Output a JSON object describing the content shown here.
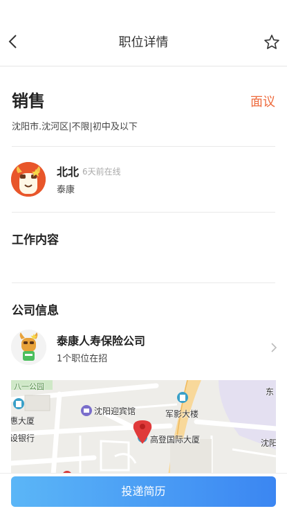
{
  "header": {
    "title": "职位详情"
  },
  "job": {
    "title": "销售",
    "salary": "面议",
    "meta": "沈阳市.沈河区|不限|初中及以下"
  },
  "contact": {
    "name": "北北",
    "online": "6天前在线",
    "company": "泰康"
  },
  "sections": {
    "work_content": "工作内容",
    "company_info": "公司信息"
  },
  "company": {
    "name": "泰康人寿保险公司",
    "positions": "1个职位在招"
  },
  "map": {
    "labels": {
      "park": "八一公园",
      "hotel": "沈阳迎宾馆",
      "junying": "军影大楼",
      "huida": "惠大厦",
      "bank": "设银行",
      "gaodeng": "高登国际大厦",
      "east": "东",
      "shenyang": "沈阳"
    }
  },
  "actions": {
    "apply": "投递简历"
  },
  "colors": {
    "accent": "#ee6a3c",
    "button_start": "#5bb6f7",
    "button_end": "#3b86f2"
  }
}
